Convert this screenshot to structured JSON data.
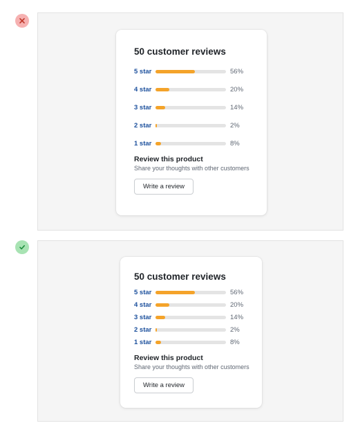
{
  "examples": [
    {
      "status": "incorrect",
      "title": "50 customer reviews",
      "ratings": [
        {
          "label": "5 star",
          "percent": 56,
          "percent_label": "56%"
        },
        {
          "label": "4 star",
          "percent": 20,
          "percent_label": "20%"
        },
        {
          "label": "3 star",
          "percent": 14,
          "percent_label": "14%"
        },
        {
          "label": "2 star",
          "percent": 2,
          "percent_label": "2%"
        },
        {
          "label": "1 star",
          "percent": 8,
          "percent_label": "8%"
        }
      ],
      "review_title": "Review this product",
      "review_subtitle": "Share your thoughts with other customers",
      "button_label": "Write a review"
    },
    {
      "status": "correct",
      "title": "50 customer reviews",
      "ratings": [
        {
          "label": "5 star",
          "percent": 56,
          "percent_label": "56%"
        },
        {
          "label": "4 star",
          "percent": 20,
          "percent_label": "20%"
        },
        {
          "label": "3 star",
          "percent": 14,
          "percent_label": "14%"
        },
        {
          "label": "2 star",
          "percent": 2,
          "percent_label": "2%"
        },
        {
          "label": "1 star",
          "percent": 8,
          "percent_label": "8%"
        }
      ],
      "review_title": "Review this product",
      "review_subtitle": "Share your thoughts with other customers",
      "button_label": "Write a review"
    }
  ],
  "colors": {
    "bar_fill": "#f4a32a",
    "bar_track": "#e4e4e4",
    "link_blue": "#1b4f9c",
    "incorrect_marker": "#f6b1b1",
    "correct_marker": "#a8e3b3"
  },
  "icons": {
    "incorrect": "close-icon",
    "correct": "check-icon"
  }
}
